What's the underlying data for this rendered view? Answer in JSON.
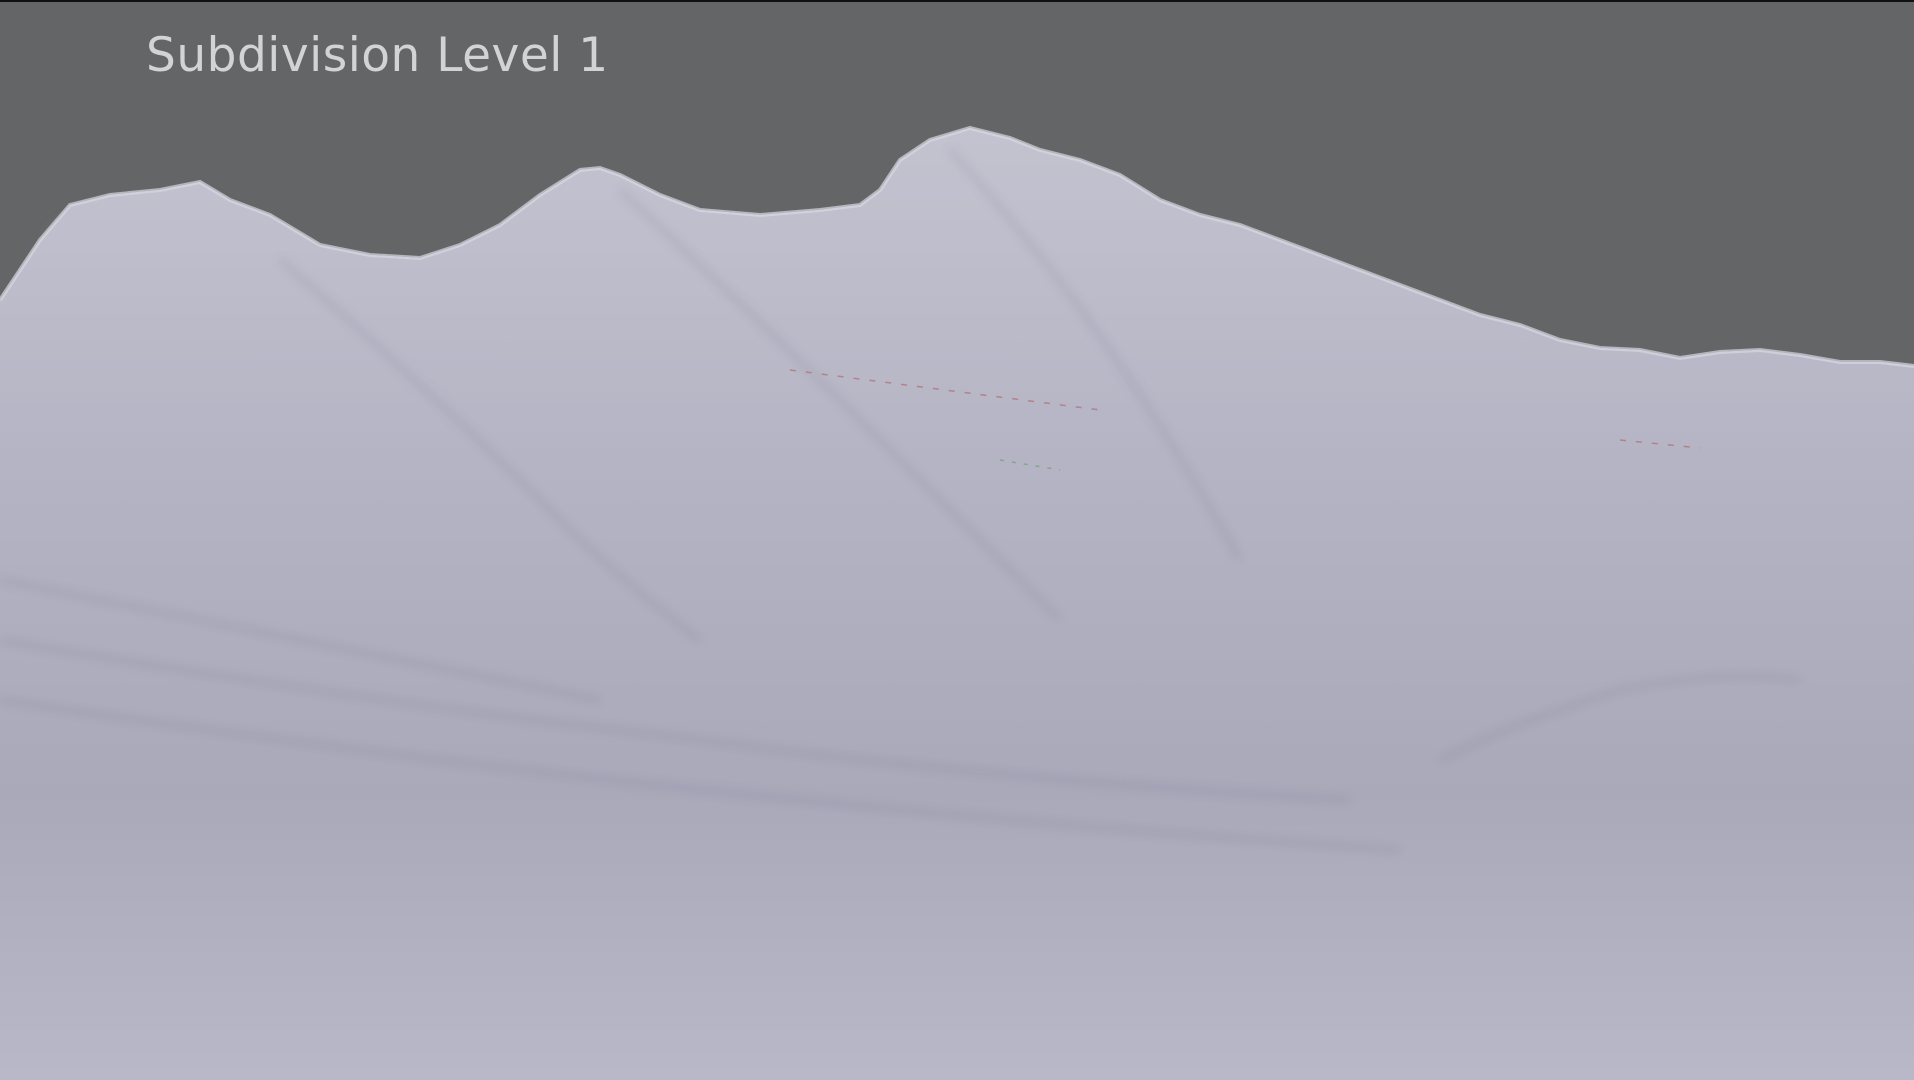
{
  "viewport": {
    "overlay_label": "Subdivision Level 1",
    "background_color": "#636566",
    "mesh_color": "#b9b9c9",
    "mesh_shadow_color": "#5f6070",
    "mesh_highlight_color": "#d4d4df"
  }
}
